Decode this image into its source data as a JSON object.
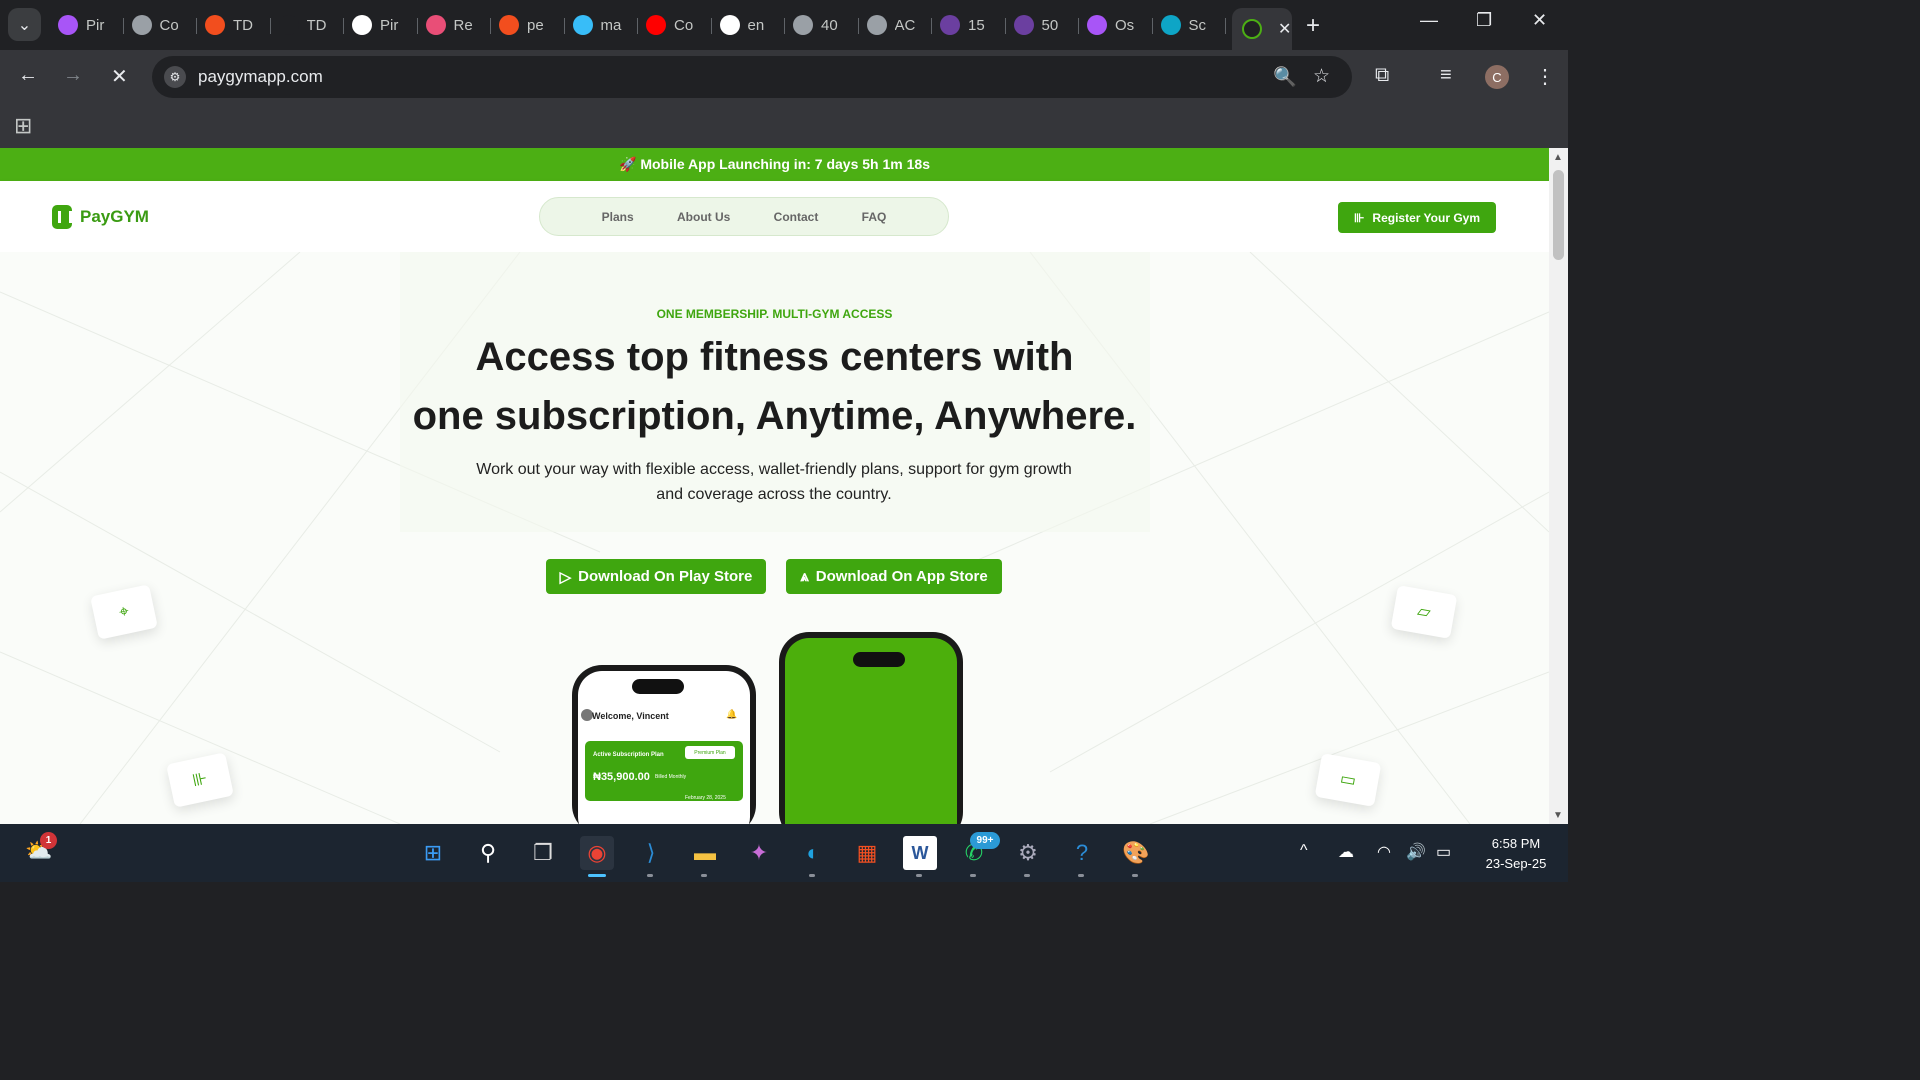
{
  "browser": {
    "tabs": [
      {
        "title": "Pir",
        "icon": "vite-icon",
        "color": "#a855f7"
      },
      {
        "title": "Co",
        "icon": "globe-icon",
        "color": "#9aa0a6"
      },
      {
        "title": "TD",
        "icon": "figma-icon",
        "color": "#f24e1e"
      },
      {
        "title": "TD",
        "icon": "play-icon",
        "color": "#202124"
      },
      {
        "title": "Pir",
        "icon": "github-icon",
        "color": "#ffffff"
      },
      {
        "title": "Re",
        "icon": "react-icon",
        "color": "#e94e77"
      },
      {
        "title": "pe",
        "icon": "figma-icon",
        "color": "#f24e1e"
      },
      {
        "title": "ma",
        "icon": "tailwind-icon",
        "color": "#38bdf8"
      },
      {
        "title": "Co",
        "icon": "youtube-icon",
        "color": "#ff0000"
      },
      {
        "title": "en",
        "icon": "triangle-icon",
        "color": "#ffffff"
      },
      {
        "title": "40",
        "icon": "globe-icon",
        "color": "#9aa0a6"
      },
      {
        "title": "AC",
        "icon": "globe-icon",
        "color": "#9aa0a6"
      },
      {
        "title": "15",
        "icon": "colorlib-icon",
        "color": "#6b3fa0"
      },
      {
        "title": "50",
        "icon": "colorlib-icon",
        "color": "#6b3fa0"
      },
      {
        "title": "Os",
        "icon": "vite-icon",
        "color": "#a855f7"
      },
      {
        "title": "Sc",
        "icon": "s-icon",
        "color": "#0ea5c6"
      }
    ],
    "active_tab_icon": "paygym-loading-icon",
    "url": "paygymapp.com"
  },
  "site": {
    "banner": "🚀 Mobile App Launching in: 7 days 5h 1m 18s",
    "brand": "PayGYM",
    "nav": [
      "Plans",
      "About Us",
      "Contact",
      "FAQ"
    ],
    "register_label": "Register Your Gym",
    "accent": "#3fa60f",
    "hero": {
      "eyebrow": "ONE MEMBERSHIP. MULTI-GYM ACCESS",
      "title_line1": "Access top fitness centers with",
      "title_line2": "one subscription, Anytime, Anywhere.",
      "subtitle": "Work out your way with flexible access, wallet-friendly plans, support for gym growth and coverage across the country.",
      "play_store_label": "Download On Play Store",
      "app_store_label": "Download On App Store"
    },
    "phone": {
      "greeting": "Welcome, Vincent",
      "plan_label": "Active Subscription Plan",
      "plan_badge": "Premium Plan",
      "price": "₦35,900.00",
      "billing": "Billed Monthly",
      "date": "February 28, 2025"
    }
  },
  "taskbar": {
    "weather_badge": "1",
    "whatsapp_badge": "99+",
    "time": "6:58 PM",
    "date": "23-Sep-25"
  }
}
